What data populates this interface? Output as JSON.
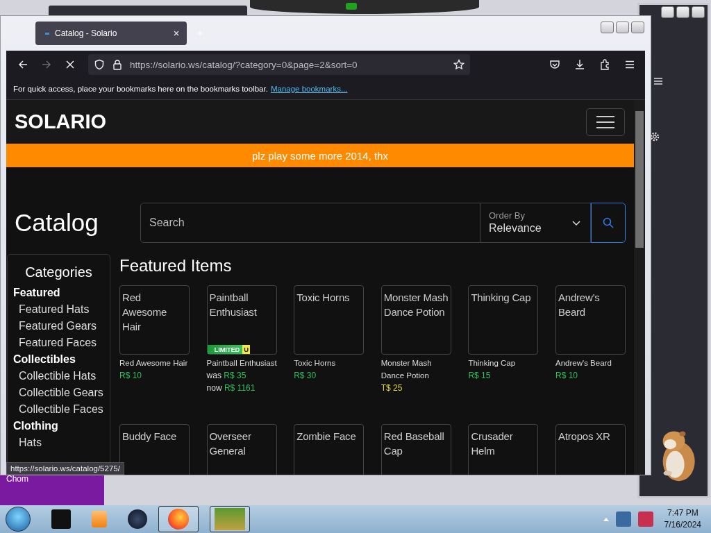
{
  "desktop": {
    "behind_text": "Chom",
    "clock": {
      "time": "7:47 PM",
      "date": "7/16/2024"
    }
  },
  "browser": {
    "tabs": [
      {
        "title": "Catalog - Solario",
        "selected": true
      }
    ],
    "forward": {
      "disabled": true
    },
    "url": "https://solario.ws/catalog/?category=0&page=2&sort=0",
    "bookmarks_hint": "For quick access, place your bookmarks here on the bookmarks toolbar.",
    "bookmarks_link": "Manage bookmarks...",
    "status_url": "https://solario.ws/catalog/5275/"
  },
  "site": {
    "brand": "SOLARIO",
    "banner": "plz play some more 2014, thx",
    "heading": "Catalog",
    "search": {
      "placeholder": "Search"
    },
    "order_by": {
      "label": "Order By",
      "value": "Relevance"
    },
    "categories": {
      "title": "Categories",
      "groups": [
        {
          "name": "Featured",
          "items": [
            "Featured Hats",
            "Featured Gears",
            "Featured Faces"
          ]
        },
        {
          "name": "Collectibles",
          "items": [
            "Collectible Hats",
            "Collectible Gears",
            "Collectible Faces"
          ]
        },
        {
          "name": "Clothing",
          "items": [
            "Hats"
          ]
        }
      ]
    },
    "featured": {
      "title": "Featured Items",
      "items": [
        {
          "title": "Red Awesome Hair",
          "name": "Red Awesome Hair",
          "prices": [
            {
              "text": "R$ 10",
              "kind": "robux"
            }
          ]
        },
        {
          "title": "Paintball Enthusiast",
          "name": "Paintball Enthusiast",
          "badge": {
            "text": "LIMITED",
            "tag": "U"
          },
          "prices": [
            {
              "prefix": "was",
              "text": "R$ 35",
              "kind": "robux"
            },
            {
              "prefix": "now",
              "text": "R$ 1161",
              "kind": "robux"
            }
          ]
        },
        {
          "title": "Toxic Horns",
          "name": "Toxic Horns",
          "prices": [
            {
              "text": "R$ 30",
              "kind": "robux"
            }
          ]
        },
        {
          "title": "Monster Mash Dance Potion",
          "name": "Monster Mash Dance Potion",
          "prices": [
            {
              "text": "T$ 25",
              "kind": "tix"
            }
          ]
        },
        {
          "title": "Thinking Cap",
          "name": "Thinking Cap",
          "prices": [
            {
              "text": "R$ 15",
              "kind": "robux"
            }
          ]
        },
        {
          "title": "Andrew's Beard",
          "name": "Andrew's Beard",
          "prices": [
            {
              "text": "R$ 10",
              "kind": "robux"
            }
          ]
        },
        {
          "title": "Buddy Face"
        },
        {
          "title": "Overseer General"
        },
        {
          "title": "Zombie Face"
        },
        {
          "title": "Red Baseball Cap"
        },
        {
          "title": "Crusader Helm"
        },
        {
          "title": "Atropos XR"
        }
      ]
    }
  }
}
